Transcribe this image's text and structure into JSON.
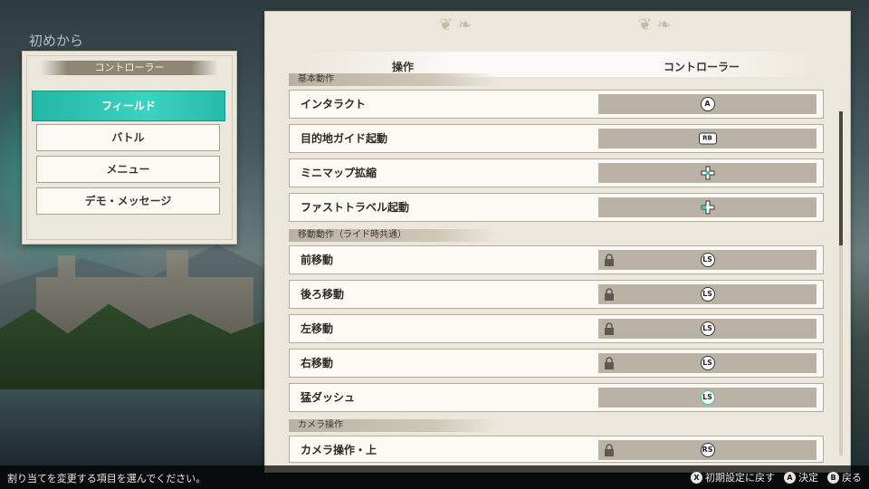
{
  "window_tab": "初めから",
  "left_panel": {
    "header": "コントローラー",
    "categories": [
      {
        "label": "フィールド",
        "active": true
      },
      {
        "label": "バトル",
        "active": false
      },
      {
        "label": "メニュー",
        "active": false
      },
      {
        "label": "デモ・メッセージ",
        "active": false
      }
    ]
  },
  "right_panel": {
    "col_operation": "操作",
    "col_controller": "コントローラー",
    "sections": [
      {
        "label": "基本動作"
      },
      {
        "label": "移動動作（ライド時共通）"
      },
      {
        "label": "カメラ操作"
      }
    ],
    "rows": [
      {
        "label": "インタラクト",
        "button": "A",
        "glyph": "circle",
        "locked": false
      },
      {
        "label": "目的地ガイド起動",
        "button": "RB",
        "glyph": "rb",
        "locked": false
      },
      {
        "label": "ミニマップ拡縮",
        "button": "dpad",
        "glyph": "dpad",
        "locked": false
      },
      {
        "label": "ファストトラベル起動",
        "button": "dpad",
        "glyph": "dpad",
        "locked": false
      },
      {
        "label": "前移動",
        "button": "LS",
        "glyph": "circle",
        "locked": true
      },
      {
        "label": "後ろ移動",
        "button": "LS",
        "glyph": "circle",
        "locked": true
      },
      {
        "label": "左移動",
        "button": "LS",
        "glyph": "circle",
        "locked": true
      },
      {
        "label": "右移動",
        "button": "LS",
        "glyph": "circle",
        "locked": true
      },
      {
        "label": "猛ダッシュ",
        "button": "LS",
        "glyph": "circle",
        "locked": false
      },
      {
        "label": "カメラ操作・上",
        "button": "RS",
        "glyph": "circle",
        "locked": true
      }
    ]
  },
  "footer": {
    "hint": "割り当てを変更する項目を選んでください。",
    "actions": [
      {
        "key": "X",
        "label": "初期設定に戻す"
      },
      {
        "key": "A",
        "label": "決定"
      },
      {
        "key": "B",
        "label": "戻る"
      }
    ]
  },
  "colors": {
    "accent": "#2ec4b1",
    "panel": "#ece7dc",
    "binding_bg": "#b9b2a5",
    "footer_bg": "#000000"
  }
}
